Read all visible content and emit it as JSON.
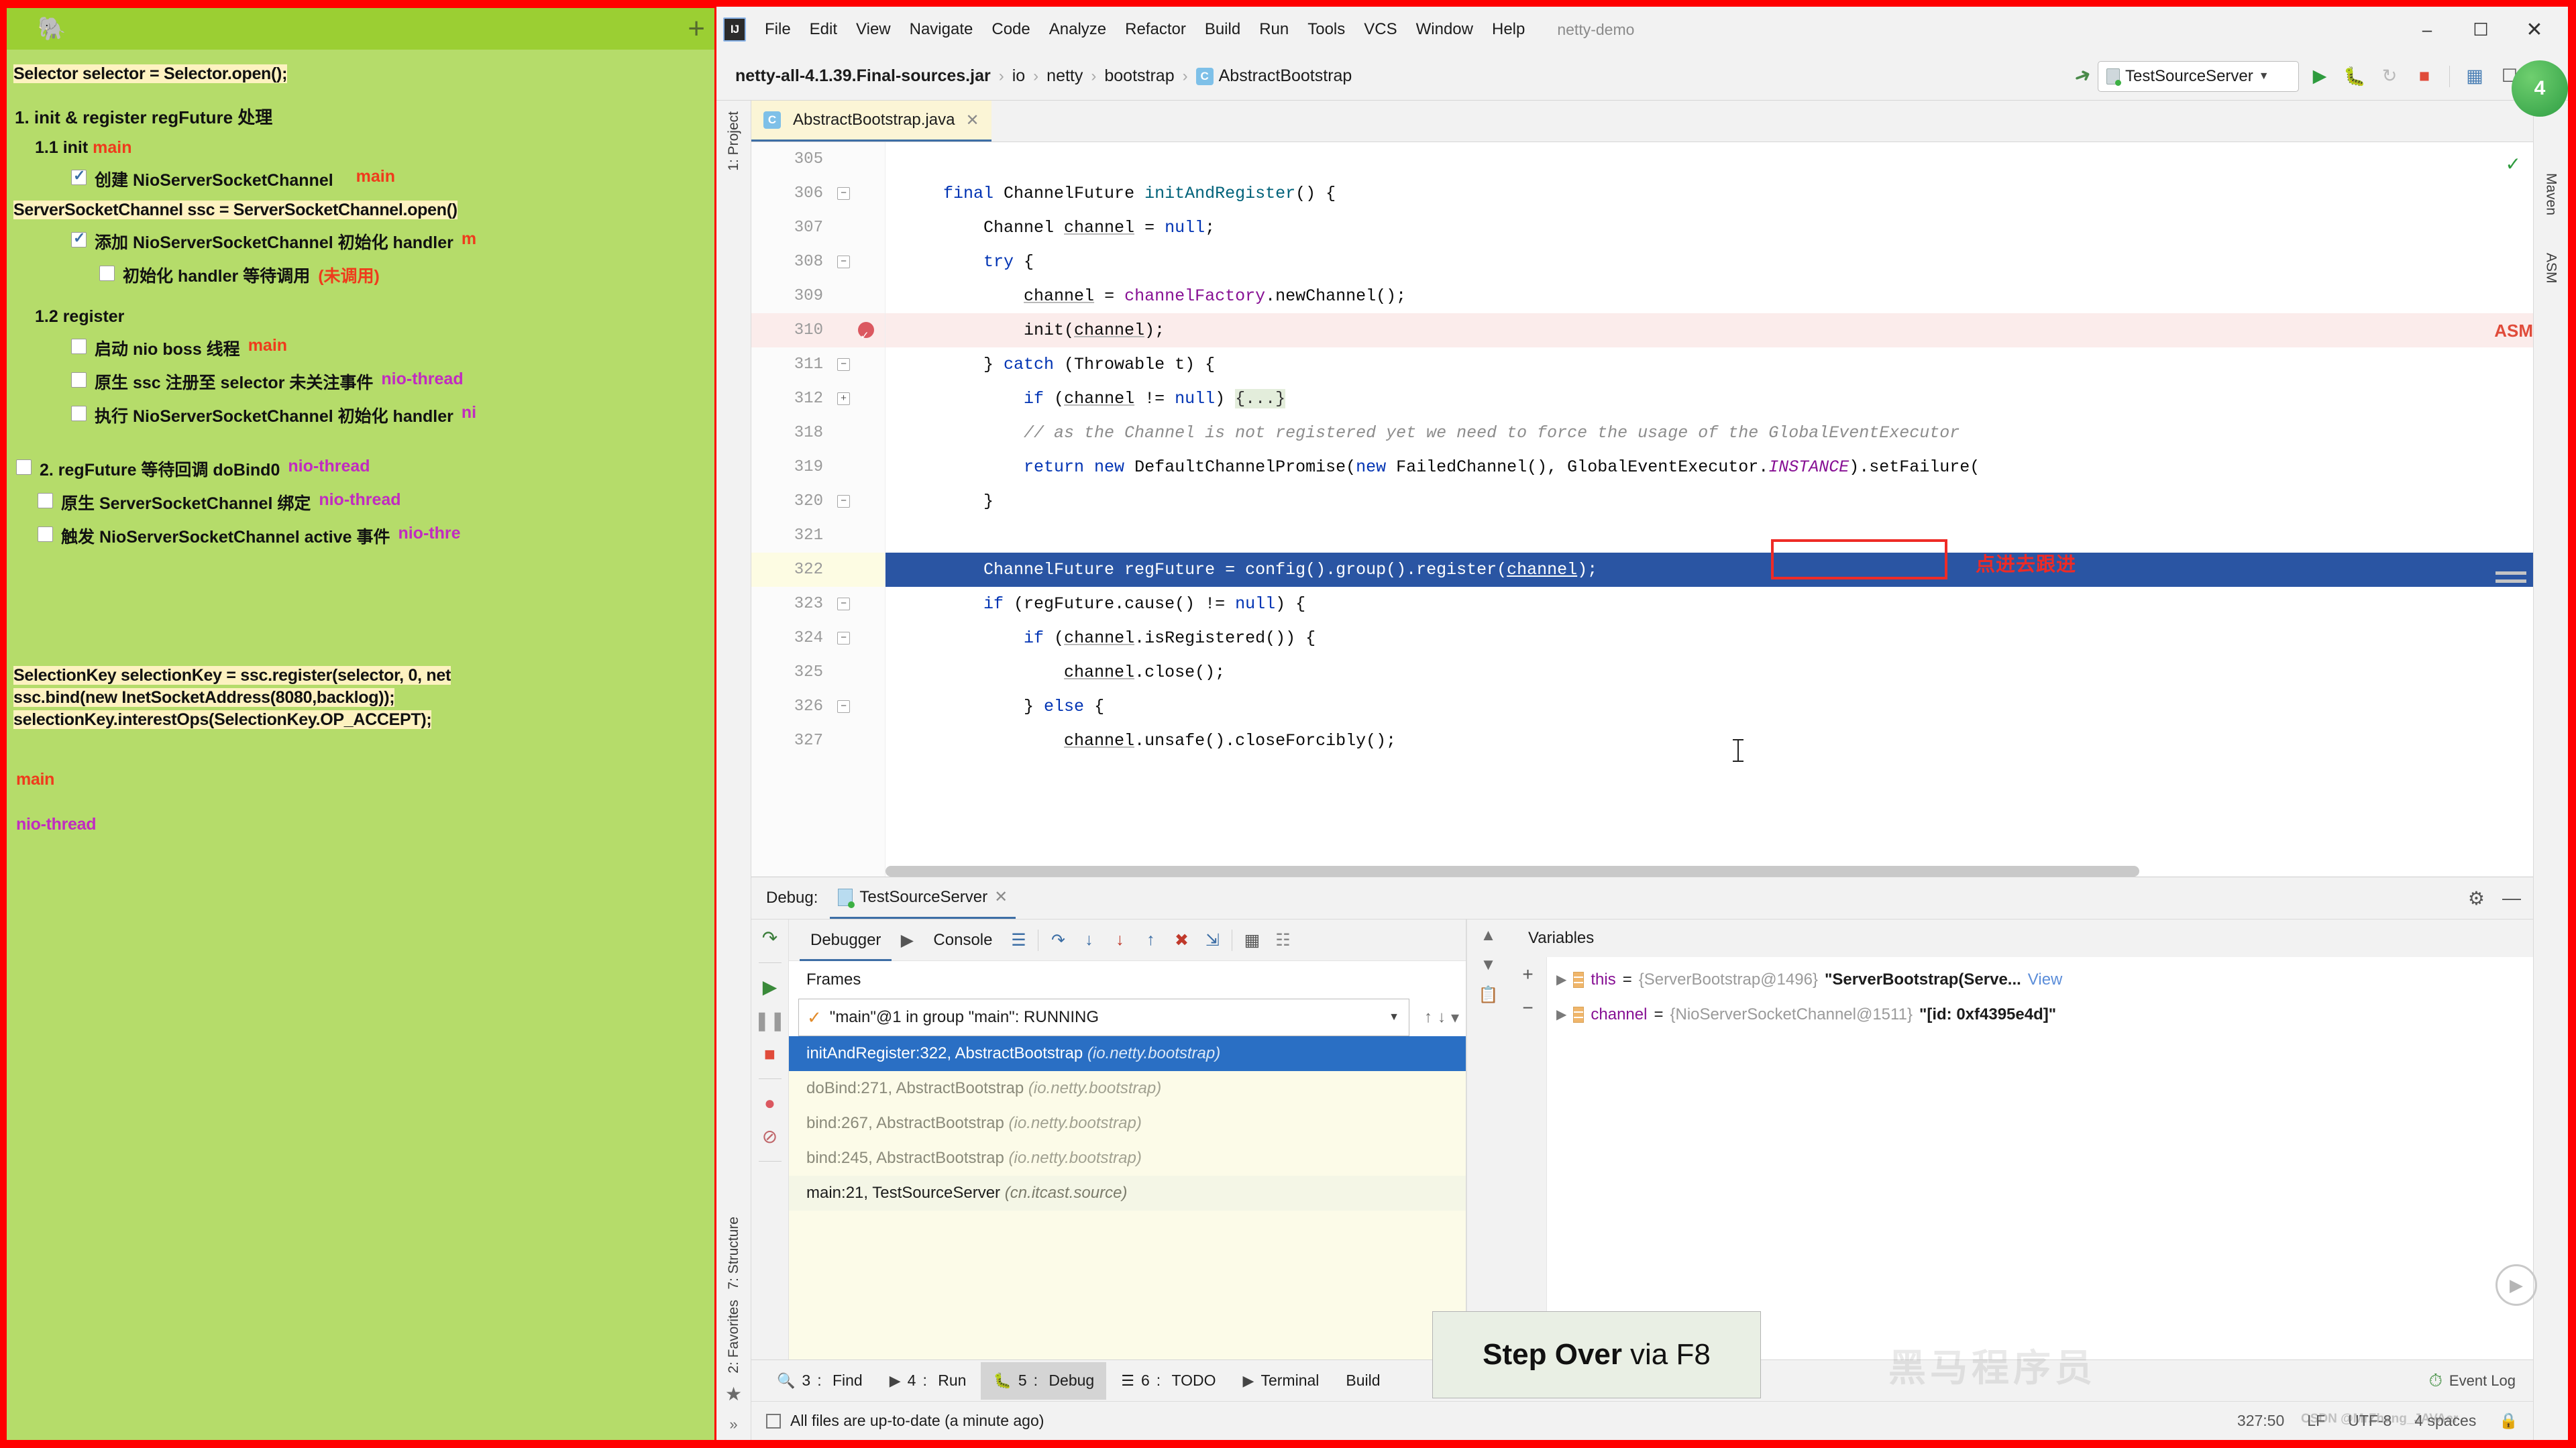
{
  "notes": {
    "app": "Evernote",
    "add_label": "+",
    "code_snippet_1": "Selector selector = Selector.open();",
    "section1": "1. init & register regFuture 处理",
    "sub11_prefix": "1.1 init ",
    "sub11_thread": "main",
    "item_create": "创建 NioServerSocketChannel",
    "item_create_thread": "main",
    "code_snippet_2": "ServerSocketChannel ssc = ServerSocketChannel.open()",
    "item_addhandler": "添加 NioServerSocketChannel 初始化 handler ",
    "item_addhandler_thread": "m",
    "item_waitcall": "初始化 handler 等待调用 ",
    "item_waitcall_note": "(未调用)",
    "sub12": "1.2 register",
    "item_bossthread": "启动 nio boss 线程 ",
    "item_bossthread_thread": "main",
    "item_sscregister": "原生 ssc 注册至 selector 未关注事件 ",
    "item_sscregister_thread": "nio-thread",
    "item_exechandler": "执行 NioServerSocketChannel 初始化 handler ",
    "item_exechandler_thread": "ni",
    "section2": "2. regFuture 等待回调 doBind0 ",
    "section2_thread": "nio-thread",
    "item_sscbind": "原生 ServerSocketChannel 绑定 ",
    "item_sscbind_thread": "nio-thread",
    "item_active": "触发 NioServerSocketChannel active 事件 ",
    "item_active_thread": "nio-thre",
    "code_snippet_3": "SelectionKey selectionKey = ssc.register(selector, 0, net",
    "code_snippet_4": "ssc.bind(new InetSocketAddress(8080,backlog));",
    "code_snippet_5": "selectionKey.interestOps(SelectionKey.OP_ACCEPT);",
    "legend_main": "main",
    "legend_nio": "nio-thread",
    "color_main": "#ef3b1c",
    "color_nio": "#c12bc1",
    "bg": "#b5dc6a",
    "header_bg": "#9bcf33"
  },
  "idea": {
    "logo": "IJ",
    "menu": [
      "File",
      "Edit",
      "View",
      "Navigate",
      "Code",
      "Analyze",
      "Refactor",
      "Build",
      "Run",
      "Tools",
      "VCS",
      "Window",
      "Help"
    ],
    "project_name": "netty-demo",
    "window_controls": {
      "minimize": "–",
      "maximize": "☐",
      "close": "✕"
    },
    "breadcrumb": {
      "root": "netty-all-4.1.39.Final-sources.jar",
      "parts": [
        "io",
        "netty",
        "bootstrap"
      ],
      "class_badge": "C",
      "class_name": "AbstractBootstrap",
      "separator": "›"
    },
    "run_config": "TestSourceServer",
    "toolbar_icons": [
      "hammer-icon",
      "run-icon",
      "debug-icon",
      "rerun-icon",
      "stop-icon",
      "coverage-icon",
      "project-structure-icon",
      "search-icon"
    ],
    "left_strip": [
      "1: Project",
      "7: Structure",
      "2: Favorites"
    ],
    "right_strip": [
      "Maven",
      "ASM"
    ],
    "maven_badge": "4",
    "asm_badge": "ASM",
    "editor_tab": {
      "badge": "C",
      "name": "AbstractBootstrap.java",
      "close": "✕"
    }
  },
  "code": {
    "lines": [
      {
        "num": "305",
        "text": "",
        "state": "normal",
        "fold": ""
      },
      {
        "num": "306",
        "text": "final ChannelFuture initAndRegister() {",
        "state": "normal",
        "fold": "minus"
      },
      {
        "num": "307",
        "text": "Channel channel = null;",
        "state": "normal",
        "fold": ""
      },
      {
        "num": "308",
        "text": "try {",
        "state": "normal",
        "fold": "minus"
      },
      {
        "num": "309",
        "text": "channel = channelFactory.newChannel();",
        "state": "normal",
        "fold": ""
      },
      {
        "num": "310",
        "text": "init(channel);",
        "state": "breakpoint",
        "fold": ""
      },
      {
        "num": "311",
        "text": "} catch (Throwable t) {",
        "state": "normal",
        "fold": "minus"
      },
      {
        "num": "312",
        "text": "if (channel != null) {...}",
        "state": "normal",
        "fold": "plus"
      },
      {
        "num": "318",
        "text": "// as the Channel is not registered yet we need to force the usage of the GlobalEventExecutor",
        "state": "comment",
        "fold": ""
      },
      {
        "num": "319",
        "text": "return new DefaultChannelPromise(new FailedChannel(), GlobalEventExecutor.INSTANCE).setFailure(",
        "state": "normal",
        "fold": ""
      },
      {
        "num": "320",
        "text": "}",
        "state": "normal",
        "fold": "minus"
      },
      {
        "num": "321",
        "text": "",
        "state": "normal",
        "fold": ""
      },
      {
        "num": "322",
        "text": "ChannelFuture regFuture = config().group().register(channel);",
        "state": "selected",
        "fold": ""
      },
      {
        "num": "323",
        "text": "if (regFuture.cause() != null) {",
        "state": "normal",
        "fold": "minus"
      },
      {
        "num": "324",
        "text": "if (channel.isRegistered()) {",
        "state": "normal",
        "fold": "minus"
      },
      {
        "num": "325",
        "text": "channel.close();",
        "state": "normal",
        "fold": ""
      },
      {
        "num": "326",
        "text": "} else {",
        "state": "normal",
        "fold": "minus"
      },
      {
        "num": "327",
        "text": "channel.unsafe().closeForcibly();",
        "state": "normal",
        "fold": ""
      }
    ],
    "annotation": "点进去跟进",
    "annotation_color": "#ee2b26",
    "redbox_target": "register(channel);"
  },
  "debug": {
    "title_label": "Debug:",
    "session_tab": "TestSourceServer",
    "session_close": "✕",
    "tabs": [
      {
        "label": "Debugger",
        "active": true
      },
      {
        "label": "Console",
        "active": false
      }
    ],
    "frames_header": "Frames",
    "thread_selector": "\"main\"@1 in group \"main\": RUNNING",
    "frames": [
      {
        "text": "initAndRegister:322, AbstractBootstrap ",
        "pkg": "(io.netty.bootstrap)",
        "selected": true
      },
      {
        "text": "doBind:271, AbstractBootstrap ",
        "pkg": "(io.netty.bootstrap)",
        "selected": false
      },
      {
        "text": "bind:267, AbstractBootstrap ",
        "pkg": "(io.netty.bootstrap)",
        "selected": false
      },
      {
        "text": "bind:245, AbstractBootstrap ",
        "pkg": "(io.netty.bootstrap)",
        "selected": false
      },
      {
        "text": "main:21, TestSourceServer ",
        "pkg": "(cn.itcast.source)",
        "selected": false,
        "main": true
      }
    ],
    "variables_header": "Variables",
    "variables": [
      {
        "name": "this",
        "eq": " = ",
        "type": "{ServerBootstrap@1496}",
        "value": " \"ServerBootstrap(Serve...",
        "view": "View"
      },
      {
        "name": "channel",
        "eq": " = ",
        "type": "{NioServerSocketChannel@1511}",
        "value": " \"[id: 0xf4395e4d]\"",
        "view": ""
      }
    ],
    "side_icons": [
      "step-over-icon",
      "step-into-icon",
      "force-step-into-icon",
      "step-out-icon",
      "drop-frame-icon",
      "run-to-cursor-icon",
      "evaluate-icon",
      "settings-icon"
    ],
    "left_icons": [
      "rerun-icon",
      "resume-icon",
      "pause-icon",
      "stop-icon",
      "view-breakpoints-icon",
      "mute-breakpoints-icon"
    ]
  },
  "bottom_bar": {
    "items": [
      {
        "num": "3",
        "label": "Find",
        "icon": "search-icon",
        "active": false
      },
      {
        "num": "4",
        "label": "Run",
        "icon": "run-icon",
        "active": false
      },
      {
        "num": "5",
        "label": "Debug",
        "icon": "debug-icon",
        "active": true
      },
      {
        "num": "6",
        "label": "TODO",
        "icon": "todo-icon",
        "active": false
      },
      {
        "num": "",
        "label": "Terminal",
        "icon": "terminal-icon",
        "active": false
      },
      {
        "num": "",
        "label": "Build",
        "icon": "build-icon",
        "active": false
      }
    ],
    "event_log": "Event Log"
  },
  "status_bar": {
    "message": "All files are up-to-date (a minute ago)",
    "position": "327:50",
    "line_sep": "LF",
    "encoding": "UTF-8",
    "indent": "4 spaces",
    "lock_icon": "lock-icon"
  },
  "tooltip": {
    "bold": "Step Over",
    "rest": "via F8"
  },
  "watermarks": {
    "chinese": "黑马程序员",
    "csdn": "CSDN @MrZhang_JAVAer"
  }
}
